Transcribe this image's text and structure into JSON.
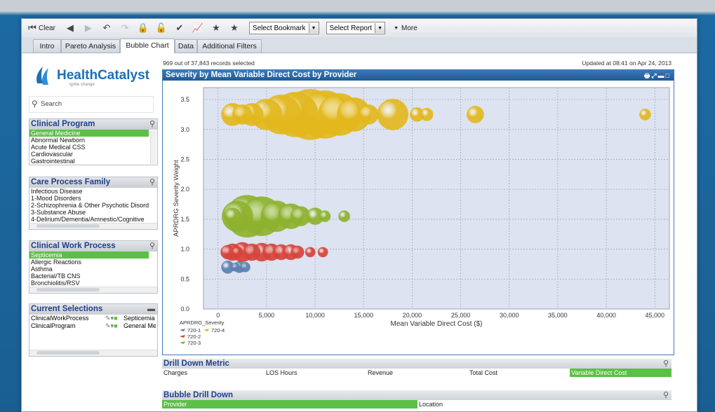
{
  "toolbar": {
    "clear_label": "Clear",
    "bookmark_select": "Select Bookmark",
    "report_select": "Select Report",
    "more_label": "More"
  },
  "tabs": [
    "Intro",
    "Pareto Analysis",
    "Bubble Chart",
    "Data",
    "Additional Filters"
  ],
  "active_tab": "Bubble Chart",
  "logo": {
    "name": "HealthCatalyst",
    "tagline": "ignite change"
  },
  "search_placeholder": "Search",
  "clinical_program": {
    "title": "Clinical Program",
    "items": [
      "General Medicine",
      "Abnormal Newborn",
      "Acute Medical CSS",
      "Cardiovascular",
      "Gastrointestinal"
    ],
    "selected": 0
  },
  "care_process_family": {
    "title": "Care Process Family",
    "items": [
      "Infectious Disease",
      "1-Mood Disorders",
      "2-Schizophrenia & Other Psychotic Disorders",
      "3-Substance Abuse",
      "4-Delirium/Dementia/Amnestic/Cognitive"
    ]
  },
  "clinical_work_process": {
    "title": "Clinical Work Process",
    "items": [
      "Septicemia",
      "Allergic Reactions",
      "Asthma",
      "Bacterial/TB CNS",
      "Bronchiolitis/RSV"
    ],
    "selected": 0
  },
  "current_selections": {
    "title": "Current Selections",
    "rows": [
      {
        "field": "ClinicalWorkProcess",
        "value": "Septicemia"
      },
      {
        "field": "ClinicalProgram",
        "value": "General Medi"
      }
    ]
  },
  "records_info": "969 out of 37,843 records selected",
  "updated_info": "Updated at 08:41 on Apr 24, 2013",
  "chart_title": "Severity by Mean Variable Direct Cost by Provider",
  "chart_data": {
    "type": "scatter",
    "title": "Severity by Mean Variable Direct Cost by Provider",
    "xlabel": "Mean Variable Direct Cost ($)",
    "ylabel": "APRDRG Severity Weight",
    "xlim": [
      -1500,
      46500
    ],
    "ylim": [
      0,
      3.7
    ],
    "xticks": [
      0,
      5000,
      10000,
      15000,
      20000,
      25000,
      30000,
      35000,
      40000,
      45000
    ],
    "xtick_labels": [
      "0",
      "5,000",
      "10,000",
      "15,000",
      "20,000",
      "25,000",
      "30,000",
      "35,000",
      "40,000",
      "45,000"
    ],
    "yticks": [
      0,
      0.5,
      1.0,
      1.5,
      2.0,
      2.5,
      3.0,
      3.5
    ],
    "ytick_labels": [
      "0.0",
      "0.5",
      "1.0",
      "1.5",
      "2.0",
      "2.5",
      "3.0",
      "3.5"
    ],
    "grid": true,
    "legend_title": "APRDRG_Severity",
    "series": [
      {
        "name": "720-1",
        "color": "#5b7fb0",
        "points": [
          [
            1000,
            0.7,
            9
          ],
          [
            2200,
            0.7,
            8
          ],
          [
            2800,
            0.7,
            7
          ],
          [
            1800,
            0.7,
            6
          ]
        ]
      },
      {
        "name": "720-2",
        "color": "#d6433a",
        "points": [
          [
            1500,
            0.95,
            12
          ],
          [
            2500,
            0.95,
            14
          ],
          [
            3500,
            0.95,
            12
          ],
          [
            4500,
            0.95,
            13
          ],
          [
            5500,
            0.95,
            12
          ],
          [
            6500,
            0.95,
            11
          ],
          [
            7500,
            0.95,
            11
          ],
          [
            8200,
            0.95,
            9
          ],
          [
            9500,
            0.95,
            7
          ],
          [
            10800,
            0.95,
            7
          ],
          [
            1000,
            0.95,
            10
          ],
          [
            2000,
            0.95,
            8
          ]
        ]
      },
      {
        "name": "720-3",
        "color": "#8db22e",
        "points": [
          [
            2000,
            1.55,
            22
          ],
          [
            3000,
            1.55,
            30
          ],
          [
            4500,
            1.55,
            28
          ],
          [
            6000,
            1.55,
            22
          ],
          [
            7500,
            1.55,
            18
          ],
          [
            8500,
            1.55,
            14
          ],
          [
            10000,
            1.55,
            12
          ],
          [
            11000,
            1.55,
            8
          ],
          [
            13000,
            1.55,
            8
          ],
          [
            1500,
            1.55,
            12
          ]
        ]
      },
      {
        "name": "720-4",
        "color": "#e2b81d",
        "points": [
          [
            1500,
            3.25,
            16
          ],
          [
            2500,
            3.25,
            14
          ],
          [
            3500,
            3.25,
            16
          ],
          [
            5000,
            3.25,
            22
          ],
          [
            6500,
            3.25,
            28
          ],
          [
            8000,
            3.25,
            32
          ],
          [
            9500,
            3.25,
            36
          ],
          [
            11000,
            3.25,
            34
          ],
          [
            12500,
            3.25,
            30
          ],
          [
            14000,
            3.25,
            24
          ],
          [
            15500,
            3.25,
            14
          ],
          [
            18000,
            3.25,
            22
          ],
          [
            20500,
            3.25,
            10
          ],
          [
            21500,
            3.25,
            9
          ],
          [
            26500,
            3.25,
            12
          ],
          [
            44000,
            3.25,
            8
          ]
        ]
      }
    ],
    "legend_layout": [
      [
        "720-1",
        "720-4"
      ],
      [
        "720-2"
      ],
      [
        "720-3"
      ]
    ]
  },
  "drill_down_metric": {
    "title": "Drill Down Metric",
    "items": [
      "Charges",
      "LOS Hours",
      "Revenue",
      "Total Cost",
      "Variable Direct Cost"
    ],
    "selected": 4
  },
  "bubble_drill_down": {
    "title": "Bubble Drill Down",
    "items": [
      "Provider",
      "Location"
    ],
    "selected": 0
  }
}
